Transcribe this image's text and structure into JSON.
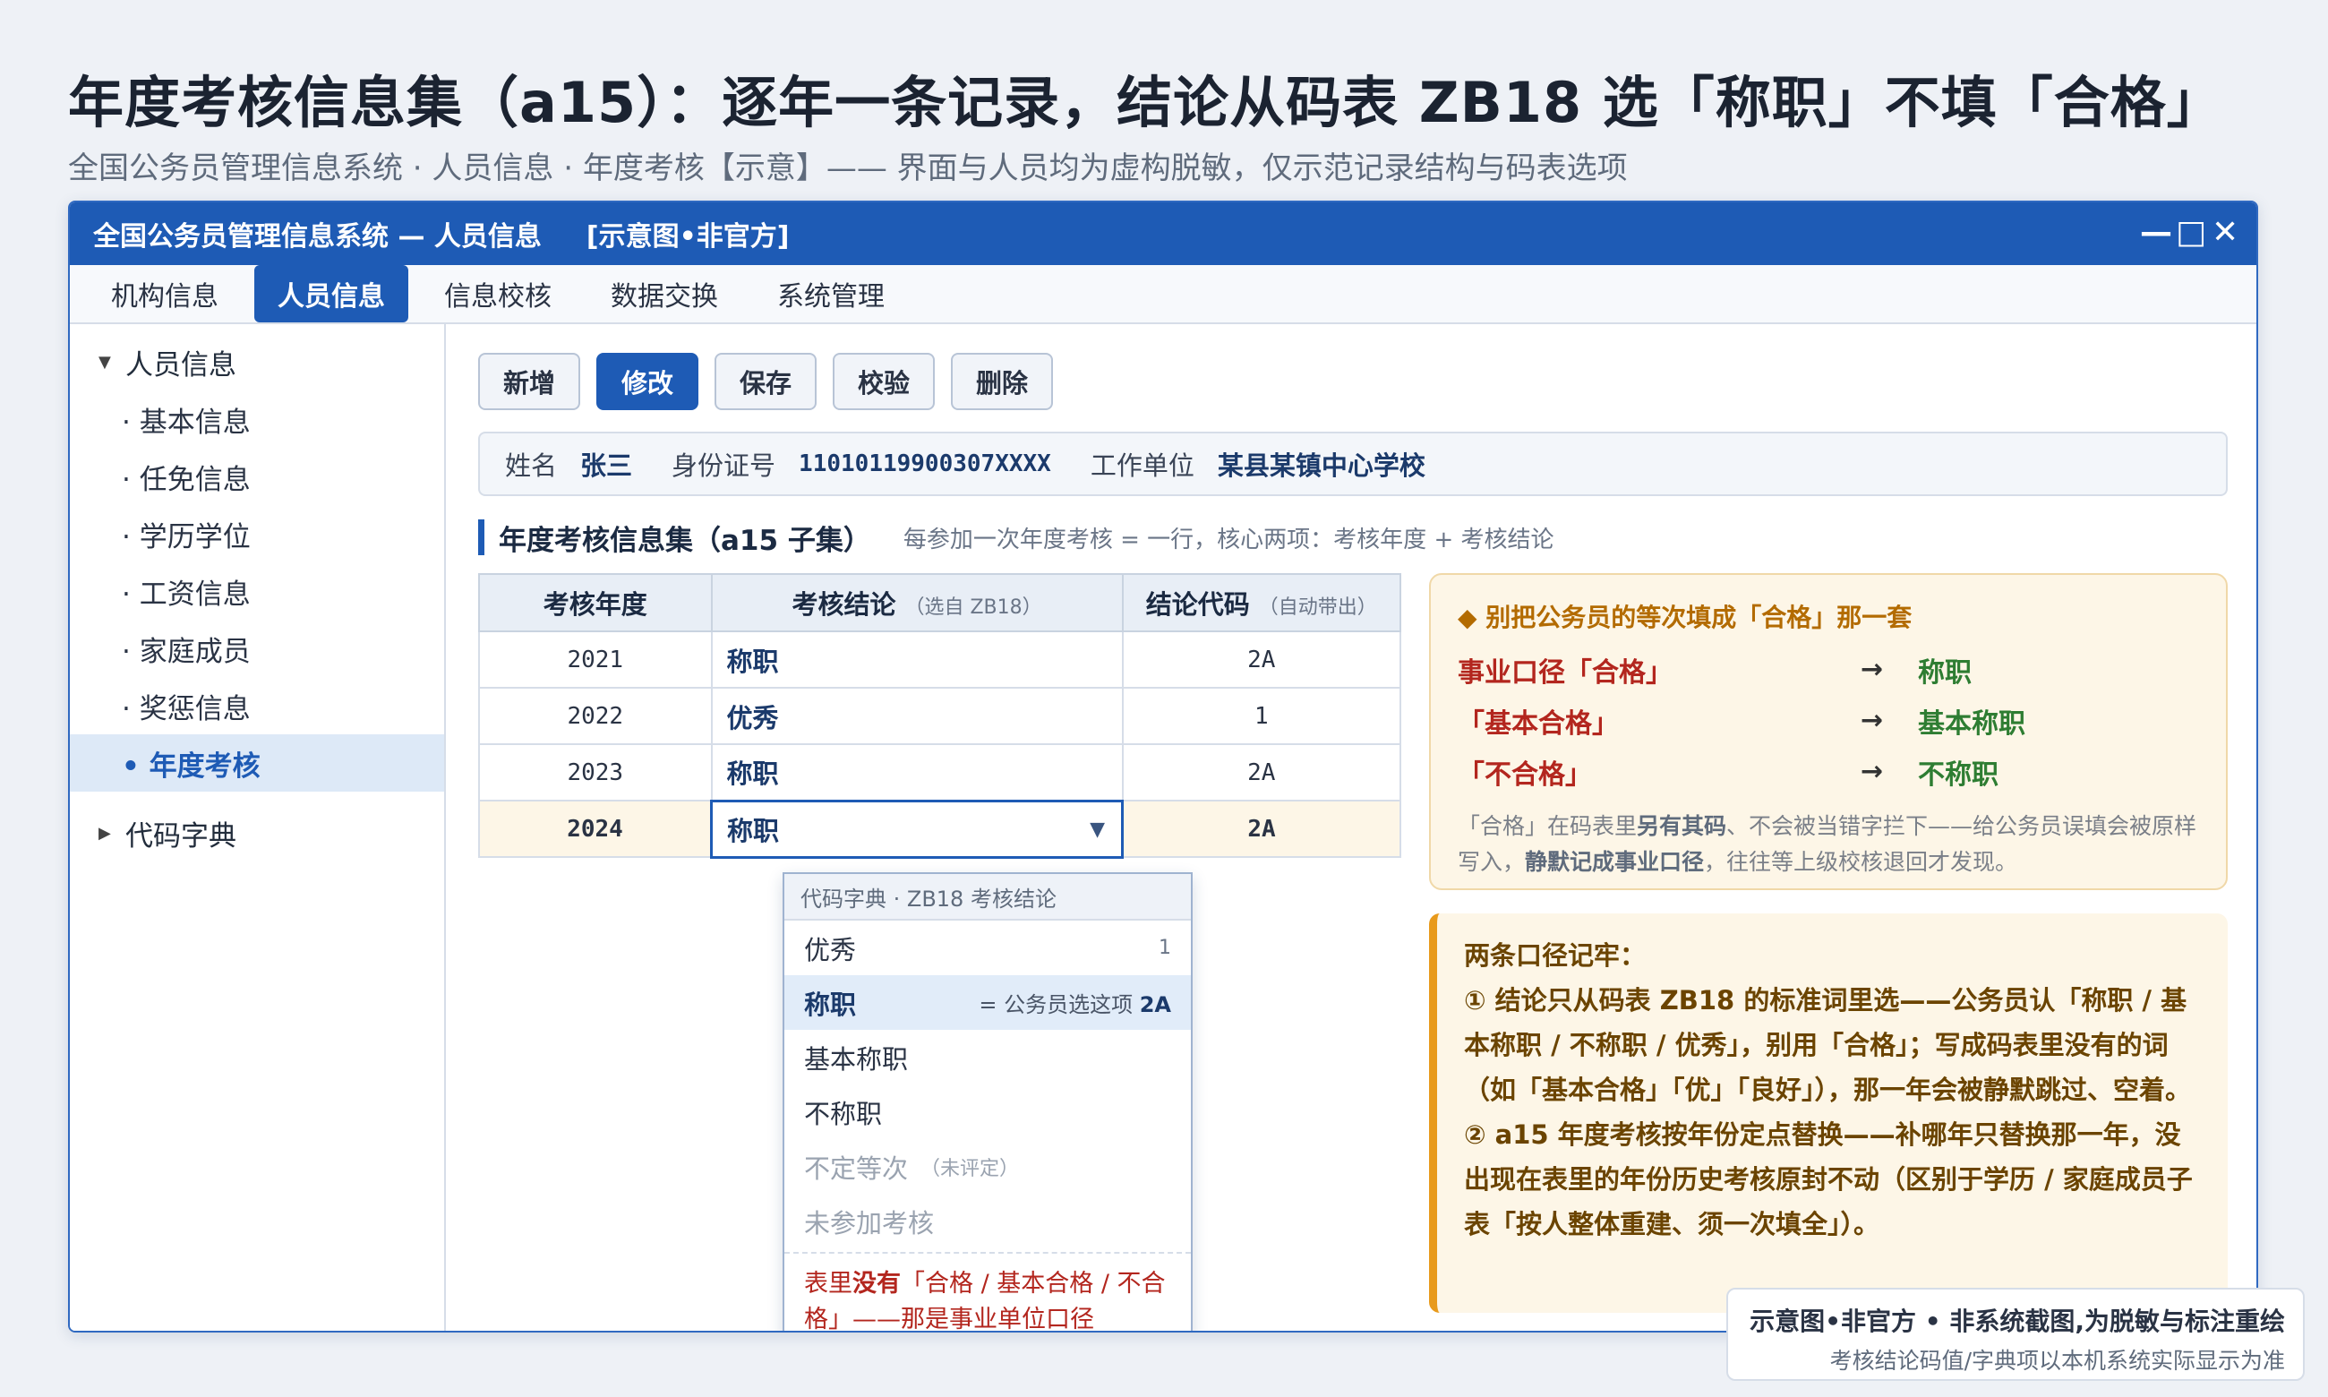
{
  "page": {
    "headline": "年度考核信息集（a15）：逐年一条记录，结论从码表 ZB18 选「称职」不填「合格」",
    "subline": "全国公务员管理信息系统 · 人员信息 · 年度考核【示意】—— 界面与人员均为虚构脱敏，仅示范记录结构与码表选项"
  },
  "window": {
    "title": "全国公务员管理信息系统 — 人员信息",
    "tag": "[示意图•非官方]",
    "controls": {
      "minimize": "—",
      "maximize": "□",
      "close": "✕"
    }
  },
  "menu": [
    {
      "label": "机构信息",
      "active": false
    },
    {
      "label": "人员信息",
      "active": true
    },
    {
      "label": "信息校核",
      "active": false
    },
    {
      "label": "数据交换",
      "active": false
    },
    {
      "label": "系统管理",
      "active": false
    }
  ],
  "sidebar": {
    "root": "人员信息",
    "items": [
      "· 基本信息",
      "· 任免信息",
      "· 学历学位",
      "· 工资信息",
      "· 家庭成员",
      "· 奖惩信息",
      "• 年度考核"
    ],
    "second_root": "代码字典"
  },
  "toolbar": {
    "new": "新增",
    "edit": "修改",
    "save": "保存",
    "check": "校验",
    "delete": "删除"
  },
  "person": {
    "name_label": "姓名",
    "name": "张三",
    "id_label": "身份证号",
    "id": "11010119900307XXXX",
    "unit_label": "工作单位",
    "unit": "某县某镇中心学校"
  },
  "section": {
    "title": "年度考核信息集（a15 子集）",
    "desc": "每参加一次年度考核 = 一行，核心两项：考核年度 + 考核结论"
  },
  "table": {
    "headers": {
      "year": "考核年度",
      "result": "考核结论",
      "result_hint": "（选自 ZB18）",
      "code": "结论代码",
      "code_hint": "（自动带出）"
    },
    "rows": [
      {
        "year": "2021",
        "result": "称职",
        "code": "2A"
      },
      {
        "year": "2022",
        "result": "优秀",
        "code": "1"
      },
      {
        "year": "2023",
        "result": "称职",
        "code": "2A"
      },
      {
        "year": "2024",
        "result": "称职",
        "code": "2A"
      }
    ],
    "select_arrow": "▼"
  },
  "dropdown": {
    "header": "代码字典 · ZB18 考核结论",
    "options": [
      {
        "label": "优秀",
        "code": "1"
      },
      {
        "label": "称职",
        "hint": "= 公务员选这项",
        "code": "2A"
      },
      {
        "label": "基本称职"
      },
      {
        "label": "不称职"
      },
      {
        "label": "不定等次",
        "sub": "（未评定）"
      },
      {
        "label": "未参加考核"
      }
    ],
    "note_pre": "表里",
    "note_em": "没有",
    "note_post": "「合格 / 基本合格 / 不合格」——那是事业单位口径"
  },
  "callout_mapping": {
    "title": "◆ 别把公务员的等次填成「合格」那一套",
    "rows": [
      {
        "from": "事业口径「合格」",
        "arrow": "→",
        "to": "称职"
      },
      {
        "from": "「基本合格」",
        "arrow": "→",
        "to": "基本称职"
      },
      {
        "from": "「不合格」",
        "arrow": "→",
        "to": "不称职"
      }
    ],
    "note_1": "「合格」在码表里",
    "note_2": "另有其码",
    "note_3": "、不会被当错字拦下——给公务员误填会被原样写入，",
    "note_4": "静默记成事业口径",
    "note_5": "，往往等上级校核退回才发现。"
  },
  "callout_rules": {
    "title": "两条口径记牢：",
    "rule1": "① 结论只从码表 ZB18 的标准词里选——公务员认「称职 / 基本称职 / 不称职 / 优秀」，别用「合格」；写成码表里没有的词（如「基本合格」「优」「良好」），那一年会被静默跳过、空着。",
    "rule2": "② a15 年度考核按年份定点替换——补哪年只替换那一年，没出现在表里的年份历史考核原封不动（区别于学历 / 家庭成员子表「按人整体重建、须一次填全」）。"
  },
  "footnote": {
    "line1": "示意图•非官方 • 非系统截图,为脱敏与标注重绘",
    "line2": "考核结论码值/字典项以本机系统实际显示为准"
  },
  "colors": {
    "brand_blue": "#1e5bb5",
    "warning_red": "#b3261e",
    "ok_green": "#2e7d32",
    "callout_bg": "#fdf6e7",
    "callout_accent": "#e89a1c"
  }
}
